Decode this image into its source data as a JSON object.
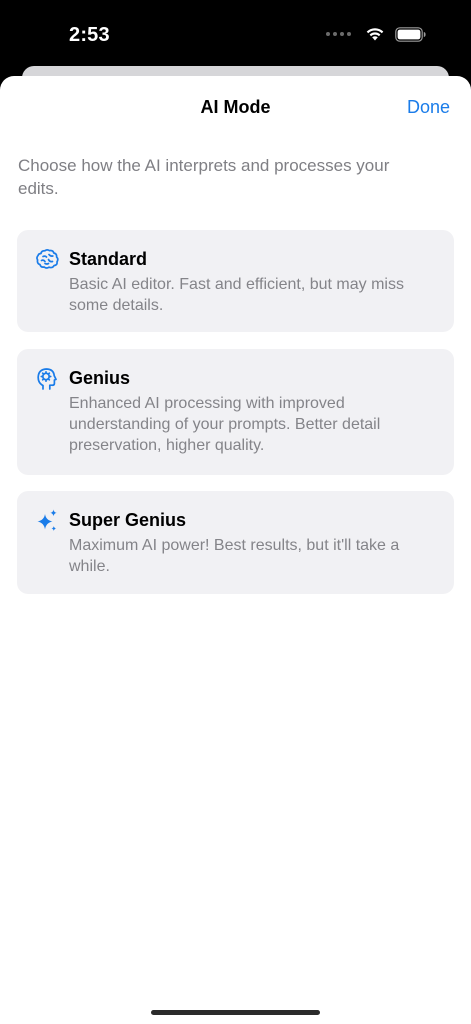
{
  "status_bar": {
    "time": "2:53"
  },
  "sheet": {
    "title": "AI Mode",
    "done_label": "Done",
    "intro": "Choose how the AI interprets and processes your edits."
  },
  "options": [
    {
      "title": "Standard",
      "description": "Basic AI editor. Fast and efficient, but may miss some details.",
      "icon": "brain-icon"
    },
    {
      "title": "Genius",
      "description": "Enhanced AI processing with improved understanding of your prompts. Better detail preservation, higher quality.",
      "icon": "brain-head-icon"
    },
    {
      "title": "Super Genius",
      "description": "Maximum AI power! Best results, but it'll take a while.",
      "icon": "sparkles-icon"
    }
  ],
  "colors": {
    "accent": "#1a7ce9",
    "card_bg": "#f1f1f4",
    "secondary_text": "#848489"
  }
}
